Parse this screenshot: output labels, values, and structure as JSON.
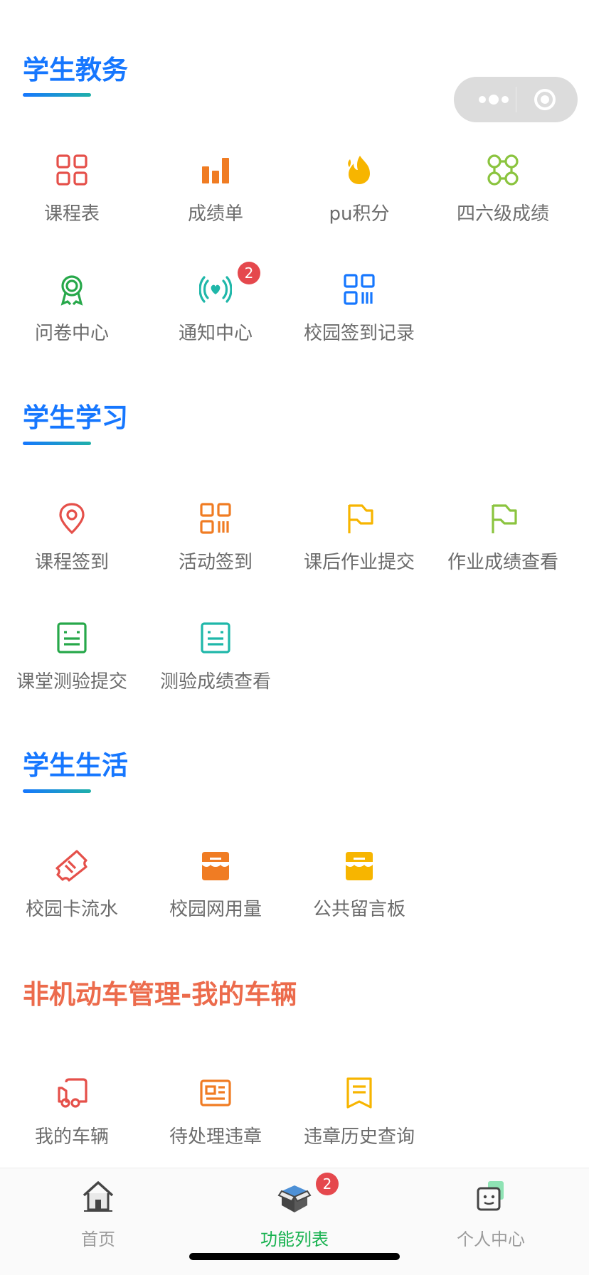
{
  "capsule": {
    "more_icon": "more-dots-icon",
    "close_icon": "target-circle-icon"
  },
  "sections": {
    "academic": {
      "title": "学生教务",
      "items": [
        {
          "label": "课程表",
          "icon": "grid-icon",
          "color": "#e5504a"
        },
        {
          "label": "成绩单",
          "icon": "bar-chart-icon",
          "color": "#f07c23"
        },
        {
          "label": "pu积分",
          "icon": "flame-icon",
          "color": "#f7b500"
        },
        {
          "label": "四六级成绩",
          "icon": "rounded-grid-icon",
          "color": "#8bc43f"
        },
        {
          "label": "问卷中心",
          "icon": "award-icon",
          "color": "#27a84a"
        },
        {
          "label": "通知中心",
          "icon": "broadcast-heart-icon",
          "color": "#1fb7a9",
          "badge": "2"
        },
        {
          "label": "校园签到记录",
          "icon": "qr-code-icon",
          "color": "#1677ff"
        }
      ]
    },
    "study": {
      "title": "学生学习",
      "items": [
        {
          "label": "课程签到",
          "icon": "location-pin-icon",
          "color": "#e5504a"
        },
        {
          "label": "活动签到",
          "icon": "qr-code-icon",
          "color": "#f07c23"
        },
        {
          "label": "课后作业提交",
          "icon": "flag-icon",
          "color": "#f7b500"
        },
        {
          "label": "作业成绩查看",
          "icon": "flag-icon",
          "color": "#8bc43f"
        },
        {
          "label": "课堂测验提交",
          "icon": "form-list-icon",
          "color": "#27a84a"
        },
        {
          "label": "测验成绩查看",
          "icon": "form-list-icon",
          "color": "#1fb7a9"
        }
      ]
    },
    "life": {
      "title": "学生生活",
      "items": [
        {
          "label": "校园卡流水",
          "icon": "ticket-icon",
          "color": "#e5504a"
        },
        {
          "label": "校园网用量",
          "icon": "store-icon",
          "color": "#f07c23"
        },
        {
          "label": "公共留言板",
          "icon": "store-icon",
          "color": "#f7b500"
        }
      ]
    },
    "vehicle": {
      "title": "非机动车管理-我的车辆",
      "items": [
        {
          "label": "我的车辆",
          "icon": "truck-icon",
          "color": "#e5504a"
        },
        {
          "label": "待处理违章",
          "icon": "id-card-icon",
          "color": "#f07c23"
        },
        {
          "label": "违章历史查询",
          "icon": "receipt-icon",
          "color": "#f7b500"
        }
      ]
    }
  },
  "tabbar": {
    "home": {
      "label": "首页",
      "icon": "house-icon"
    },
    "features": {
      "label": "功能列表",
      "icon": "open-box-icon",
      "badge": "2"
    },
    "profile": {
      "label": "个人中心",
      "icon": "face-chat-icon"
    }
  },
  "colors": {
    "accent": "#1677ff",
    "active_tab": "#18b250",
    "vehicle_title": "#ec6b4c",
    "badge": "#e5484d"
  }
}
